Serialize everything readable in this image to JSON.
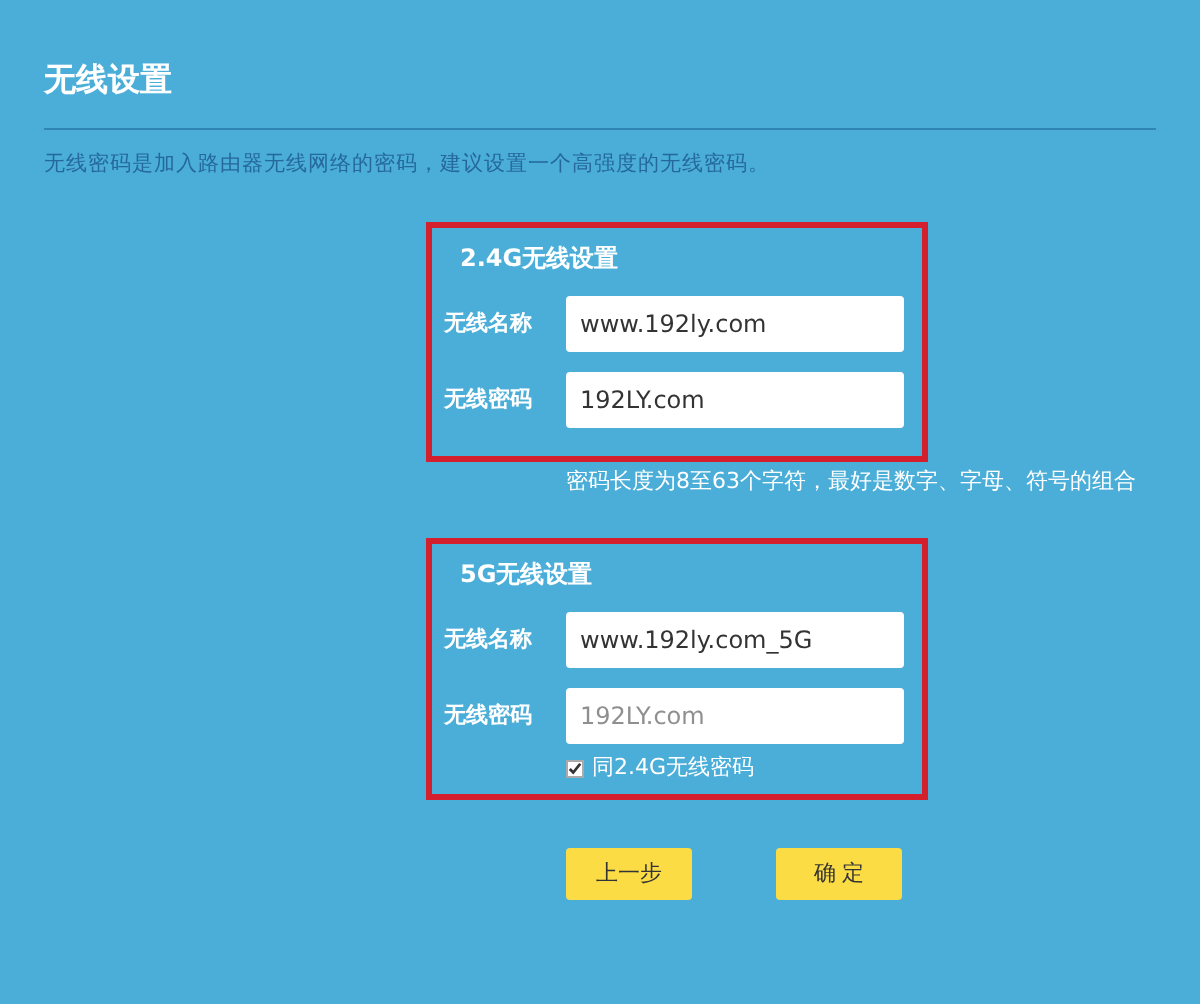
{
  "title": "无线设置",
  "description": "无线密码是加入路由器无线网络的密码，建议设置一个高强度的无线密码。",
  "groups": [
    {
      "heading": "2.4G无线设置",
      "fields": [
        {
          "label": "无线名称",
          "value": "www.192ly.com",
          "disabled": false
        },
        {
          "label": "无线密码",
          "value": "192LY.com",
          "disabled": false
        }
      ],
      "hint": "密码长度为8至63个字符，最好是数字、字母、符号的组合"
    },
    {
      "heading": "5G无线设置",
      "fields": [
        {
          "label": "无线名称",
          "value": "www.192ly.com_5G",
          "disabled": false
        },
        {
          "label": "无线密码",
          "value": "192LY.com",
          "disabled": true
        }
      ],
      "checkbox": {
        "label": "同2.4G无线密码",
        "checked": true
      }
    }
  ],
  "buttons": [
    "上一步",
    "确 定"
  ]
}
